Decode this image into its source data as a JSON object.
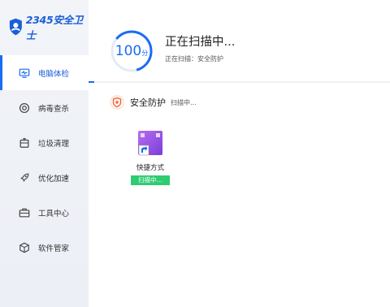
{
  "app": {
    "logo_text": "2345安全卫士"
  },
  "sidebar": {
    "items": [
      {
        "label": "电脑体检",
        "icon": "monitor-check-icon",
        "active": true
      },
      {
        "label": "病毒查杀",
        "icon": "target-icon",
        "active": false
      },
      {
        "label": "垃圾清理",
        "icon": "trash-bin-icon",
        "active": false
      },
      {
        "label": "优化加速",
        "icon": "rocket-icon",
        "active": false
      },
      {
        "label": "工具中心",
        "icon": "toolbox-icon",
        "active": false
      },
      {
        "label": "软件管家",
        "icon": "cube-icon",
        "active": false
      }
    ]
  },
  "scan": {
    "score": "100",
    "score_unit": "分",
    "title": "正在扫描中...",
    "subtitle": "正在扫描：安全防护",
    "progress": 0.02
  },
  "section": {
    "icon": "shield-plus-icon",
    "title": "安全防护",
    "status": "扫描中..."
  },
  "scan_item": {
    "icon": "shortcut-app-icon",
    "label": "快捷方式",
    "badge": "扫描中..."
  },
  "colors": {
    "accent": "#1a6cf2",
    "sidebar_bg": "#eef1f6",
    "badge_green": "#2ecc71",
    "section_icon": "#f0562a"
  }
}
